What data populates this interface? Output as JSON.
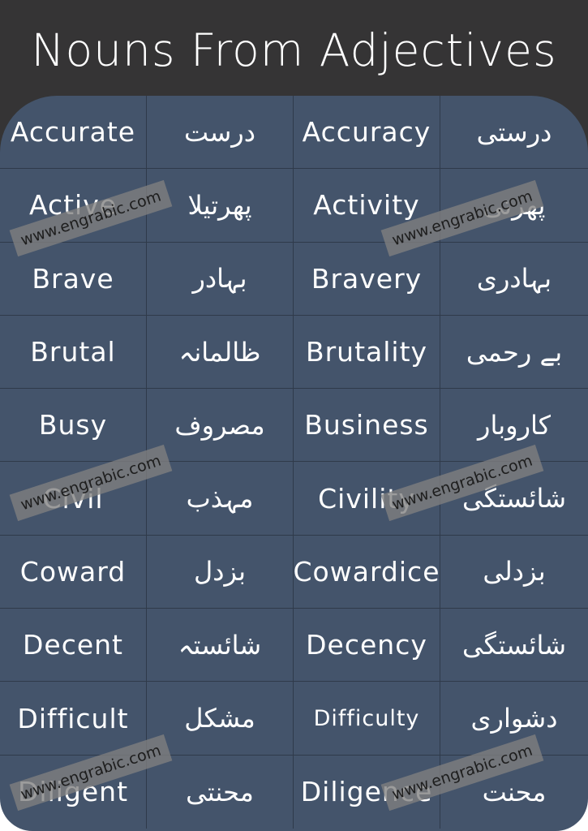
{
  "title": "Nouns From Adjectives",
  "colors": {
    "header_bg": "#353435",
    "table_bg": "#44546b",
    "text": "#ffffff",
    "watermark_bg": "#808080"
  },
  "rows": [
    {
      "adjective": "Accurate",
      "adjective_urdu": "درست",
      "noun": "Accuracy",
      "noun_urdu": "درستی"
    },
    {
      "adjective": "Active",
      "adjective_urdu": "پھرتیلا",
      "noun": "Activity",
      "noun_urdu": "پھرتی"
    },
    {
      "adjective": "Brave",
      "adjective_urdu": "بہادر",
      "noun": "Bravery",
      "noun_urdu": "بہادری"
    },
    {
      "adjective": "Brutal",
      "adjective_urdu": "ظالمانہ",
      "noun": "Brutality",
      "noun_urdu": "بے رحمی"
    },
    {
      "adjective": "Busy",
      "adjective_urdu": "مصروف",
      "noun": "Business",
      "noun_urdu": "کاروبار"
    },
    {
      "adjective": "Civil",
      "adjective_urdu": "مہذب",
      "noun": "Civility",
      "noun_urdu": "شائستگی"
    },
    {
      "adjective": "Coward",
      "adjective_urdu": "بزدل",
      "noun": "Cowardice",
      "noun_urdu": "بزدلی"
    },
    {
      "adjective": "Decent",
      "adjective_urdu": "شائستہ",
      "noun": "Decency",
      "noun_urdu": "شائستگی"
    },
    {
      "adjective": "Difficult",
      "adjective_urdu": "مشکل",
      "noun": "Difficulty",
      "noun_urdu": "دشواری"
    },
    {
      "adjective": "Diligent",
      "adjective_urdu": "محنتی",
      "noun": "Diligence",
      "noun_urdu": "محنت"
    }
  ],
  "watermark": "www.engrabic.com"
}
